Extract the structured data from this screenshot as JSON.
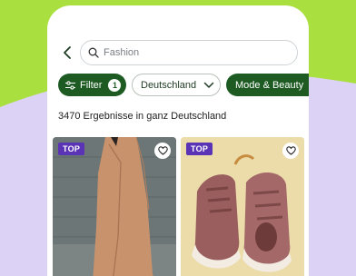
{
  "search": {
    "placeholder": "Fashion"
  },
  "filters": {
    "filter_label": "Filter",
    "filter_count": "1",
    "country_label": "Deutschland",
    "category_label": "Mode & Beauty"
  },
  "results": {
    "summary": "3470 Ergebnisse in ganz Deutschland"
  },
  "listings": [
    {
      "badge": "TOP",
      "image_icon": "coat-photo"
    },
    {
      "badge": "TOP",
      "image_icon": "sneakers-photo"
    }
  ],
  "colors": {
    "background_green": "#a9df3f",
    "background_purple": "#dcd2f5",
    "accent_green": "#1d5b23",
    "badge_purple": "#5a34b5"
  }
}
